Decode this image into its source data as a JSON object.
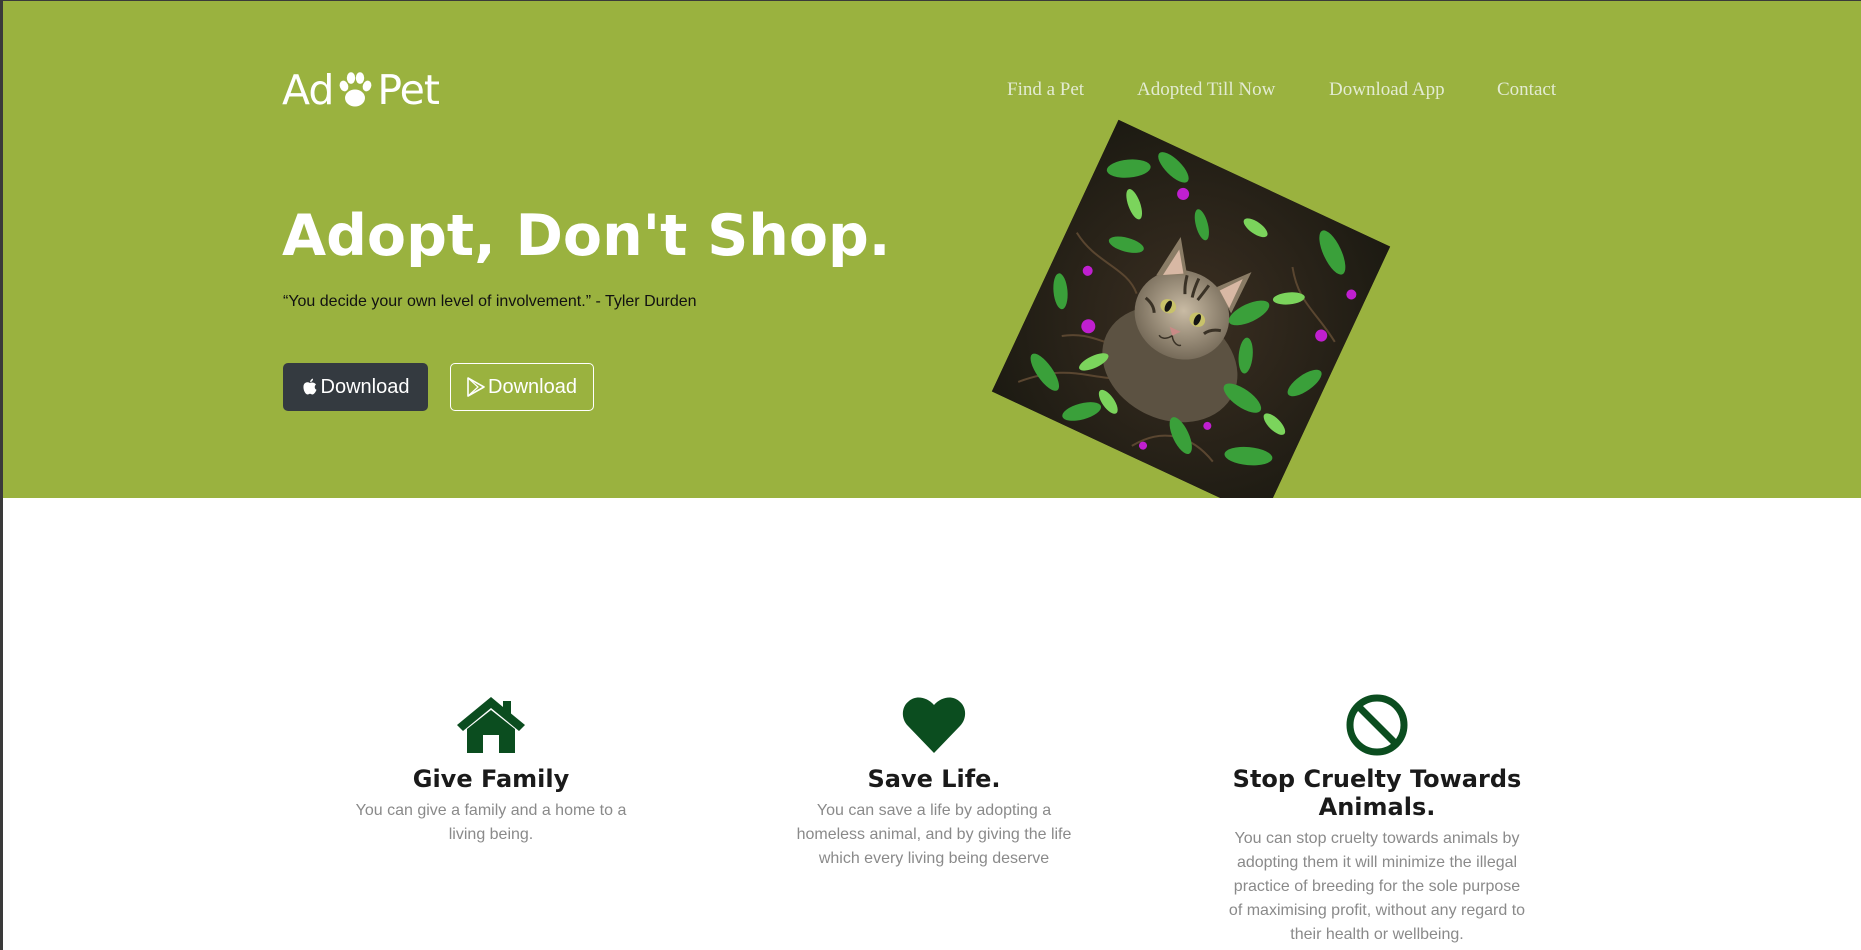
{
  "brand": {
    "logo_left": "Ad",
    "logo_right": "Pet",
    "logo_icon": "paw-icon"
  },
  "nav": {
    "items": [
      "Find a Pet",
      "Adopted Till Now",
      "Download App",
      "Contact"
    ]
  },
  "hero": {
    "headline": "Adopt, Don't Shop.",
    "quote": "“You decide your own level of involvement.” - Tyler Durden",
    "buttons": {
      "apple_label": "Download",
      "apple_icon": "apple-icon",
      "play_label": "Download",
      "play_icon": "google-play-icon"
    },
    "image": "cat-in-plants"
  },
  "colors": {
    "hero_bg": "#9ab23f",
    "icon_green": "#0b4d1f",
    "dark_button": "#343a40"
  },
  "features": [
    {
      "icon": "home-icon",
      "title": "Give Family",
      "text": "You can give a family and a home to a living being."
    },
    {
      "icon": "heart-icon",
      "title": "Save Life.",
      "text": "You can save a life by adopting a homeless animal, and by giving the life which every living being deserve"
    },
    {
      "icon": "ban-icon",
      "title": "Stop Cruelty Towards Animals.",
      "text": "You can stop cruelty towards animals by adopting them it will minimize the illegal practice of breeding for the sole purpose of maximising profit, without any regard to their health or wellbeing."
    }
  ]
}
